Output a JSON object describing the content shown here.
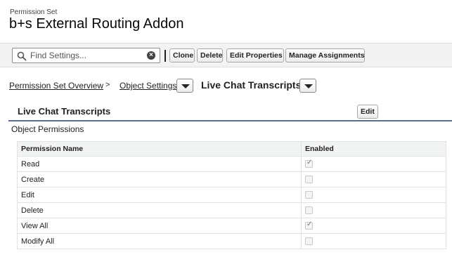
{
  "header": {
    "label": "Permission Set",
    "title": "b+s External Routing Addon"
  },
  "search": {
    "placeholder": "Find Settings...",
    "icon": "search-icon",
    "clear_icon": "clear-icon"
  },
  "toolbar": {
    "clone_label": "Clone",
    "delete_label": "Delete",
    "edit_properties_label": "Edit Properties",
    "manage_assignments_label": "Manage Assignments"
  },
  "breadcrumb": {
    "overview": "Permission Set Overview",
    "separator": ">",
    "object_settings": "Object Settings",
    "current": "Live Chat Transcripts"
  },
  "section": {
    "title": "Live Chat Transcripts",
    "edit_label": "Edit",
    "subheading": "Object Permissions"
  },
  "table": {
    "columns": [
      "Permission Name",
      "Enabled"
    ],
    "rows": [
      {
        "name": "Read",
        "enabled": true
      },
      {
        "name": "Create",
        "enabled": false
      },
      {
        "name": "Edit",
        "enabled": false
      },
      {
        "name": "Delete",
        "enabled": false
      },
      {
        "name": "View All",
        "enabled": true
      },
      {
        "name": "Modify All",
        "enabled": false
      }
    ]
  },
  "colors": {
    "section_rule": "#5a6e8c",
    "toolbar_bg": "#f3f3f3"
  }
}
